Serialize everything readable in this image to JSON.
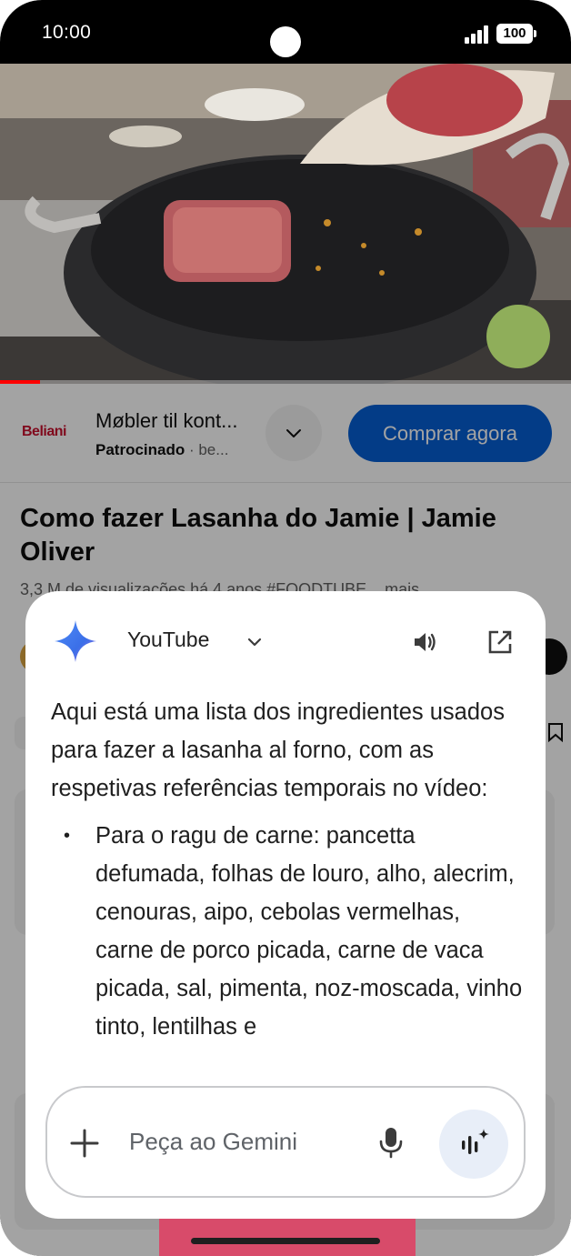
{
  "status_bar": {
    "time": "10:00",
    "battery": "100"
  },
  "video": {
    "progress_fraction": 0.07
  },
  "ad": {
    "logo": "Beliani",
    "title": "Møbler til kont...",
    "sponsored_label": "Patrocinado",
    "sponsored_rest": " · be...",
    "buy_label": "Comprar agora"
  },
  "video_info": {
    "title": "Como fazer Lasanha do Jamie | Jamie Oliver",
    "meta": "3,3 M de visualizações  há 4 anos  #FOODTUBE  ...mais"
  },
  "gemini": {
    "app_name": "YouTube",
    "icons": [
      "gemini-sparkle-icon",
      "chevron-down-icon",
      "speaker-icon",
      "open-external-icon",
      "plus-icon",
      "mic-icon",
      "gemini-live-icon"
    ],
    "response_intro": "Aqui está uma lista dos ingredientes usados para fazer a lasanha al forno, com as respetivas referências temporais no vídeo:",
    "bullets": [
      "Para o ragu de carne: pancetta defumada, folhas de louro, alho, alecrim, cenouras, aipo, cebolas vermelhas, carne de porco picada, carne de vaca picada, sal, pimenta, noz-moscada, vinho tinto, lentilhas e"
    ],
    "input_placeholder": "Peça ao Gemini"
  },
  "colors": {
    "accent_blue": "#065fd4",
    "progress_red": "#ff0000",
    "gemini_blue": "#4285f4",
    "live_button_bg": "#e8eef8"
  }
}
